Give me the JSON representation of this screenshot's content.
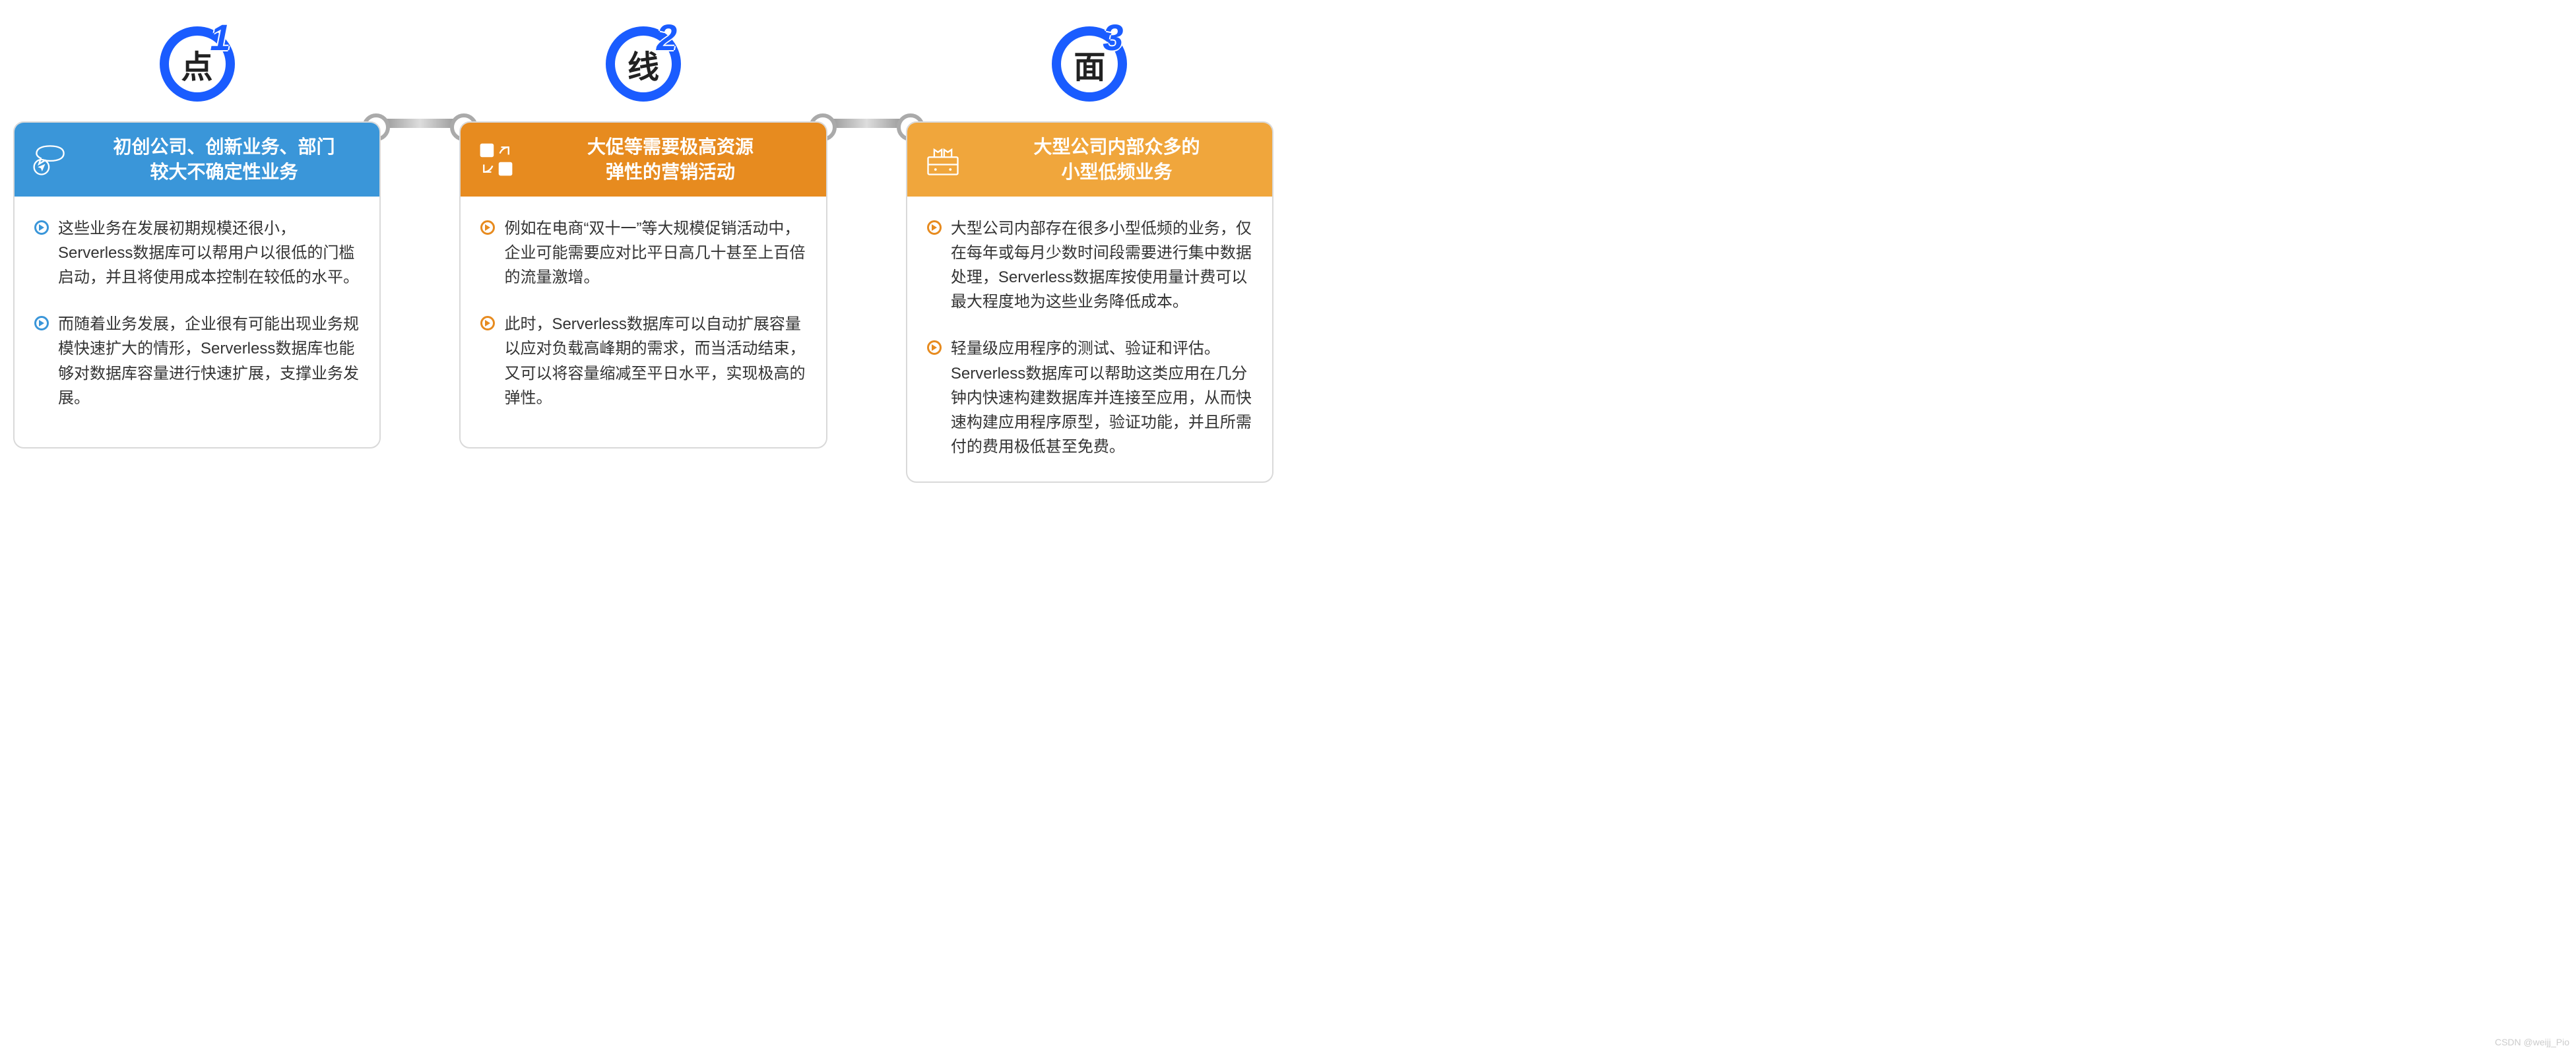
{
  "columns": [
    {
      "num": "1",
      "ch": "点",
      "title_l1": "初创公司、创新业务、部门",
      "title_l2": "较大不确定性业务",
      "bullets": [
        "这些业务在发展初期规模还很小，Serverless数据库可以帮用户以很低的门槛启动，并且将使用成本控制在较低的水平。",
        "而随着业务发展，企业很有可能出现业务规模快速扩大的情形，Serverless数据库也能够对数据库容量进行快速扩展，支撑业务发展。"
      ]
    },
    {
      "num": "2",
      "ch": "线",
      "title_l1": "大促等需要极高资源",
      "title_l2": "弹性的营销活动",
      "bullets": [
        "例如在电商“双十一”等大规模促销活动中，企业可能需要应对比平日高几十甚至上百倍的流量激增。",
        "此时，Serverless数据库可以自动扩展容量以应对负载高峰期的需求，而当活动结束，又可以将容量缩减至平日水平，实现极高的弹性。"
      ]
    },
    {
      "num": "3",
      "ch": "面",
      "title_l1": "大型公司内部众多的",
      "title_l2": "小型低频业务",
      "bullets": [
        "大型公司内部存在很多小型低频的业务，仅在每年或每月少数时间段需要进行集中数据处理，Serverless数据库按使用量计费可以最大程度地为这些业务降低成本。",
        "轻量级应用程序的测试、验证和评估。Serverless数据库可以帮助这类应用在几分钟内快速构建数据库并连接至应用，从而快速构建应用程序原型，验证功能，并且所需付的费用极低甚至免费。"
      ]
    }
  ],
  "watermark": "CSDN @weijj_Pio"
}
